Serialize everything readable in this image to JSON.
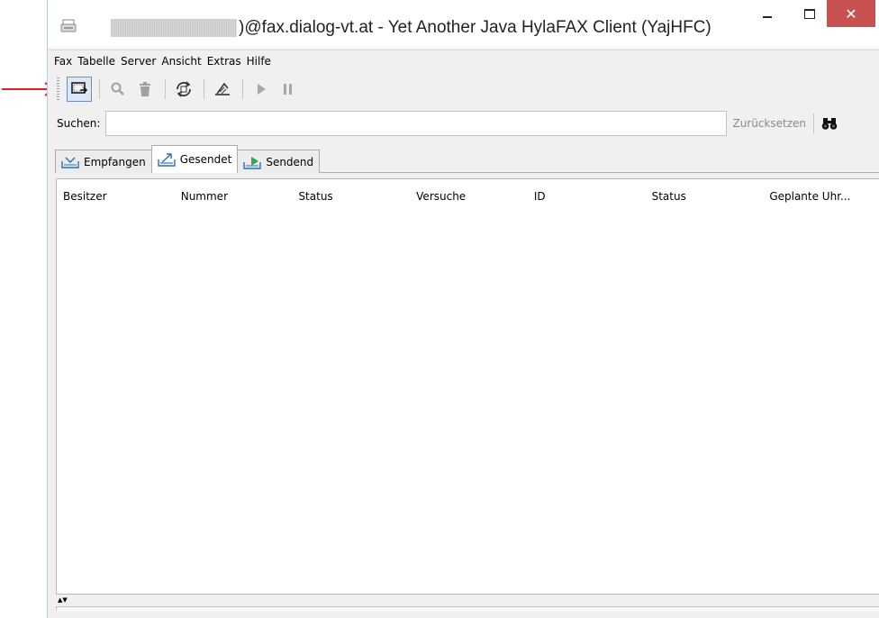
{
  "window": {
    "title": ")@fax.dialog-vt.at - Yet Another Java HylaFAX Client (YajHFC)",
    "controls": {
      "minimize": "–",
      "maximize": "□",
      "close": "✕"
    }
  },
  "menu": [
    "Fax",
    "Tabelle",
    "Server",
    "Ansicht",
    "Extras",
    "Hilfe"
  ],
  "toolbar": {
    "buttons": [
      {
        "icon": "send-fax-icon",
        "state": "pressed"
      },
      {
        "icon": "view-icon",
        "state": "disabled"
      },
      {
        "icon": "delete-icon",
        "state": "disabled"
      },
      {
        "icon": "refresh-icon",
        "state": "enabled"
      },
      {
        "icon": "phonebook-icon",
        "state": "enabled"
      },
      {
        "icon": "resume-icon",
        "state": "disabled"
      },
      {
        "icon": "suspend-icon",
        "state": "disabled"
      }
    ]
  },
  "search": {
    "label": "Suchen:",
    "value": "",
    "reset_label": "Zurücksetzen",
    "search_icon": "binoculars-icon"
  },
  "tabs": [
    {
      "label": "Empfangen",
      "icon": "received-icon",
      "active": false
    },
    {
      "label": "Gesendet",
      "icon": "sent-icon",
      "active": true
    },
    {
      "label": "Sendend",
      "icon": "sending-icon",
      "active": false
    }
  ],
  "table": {
    "columns": [
      "Besitzer",
      "Nummer",
      "Status",
      "Versuche",
      "ID",
      "Status",
      "Geplante Uhr..."
    ],
    "rows": []
  },
  "colors": {
    "close_button": "#c75050",
    "annotation_arrow": "#e02020",
    "window_bg": "#f0f0f0"
  }
}
